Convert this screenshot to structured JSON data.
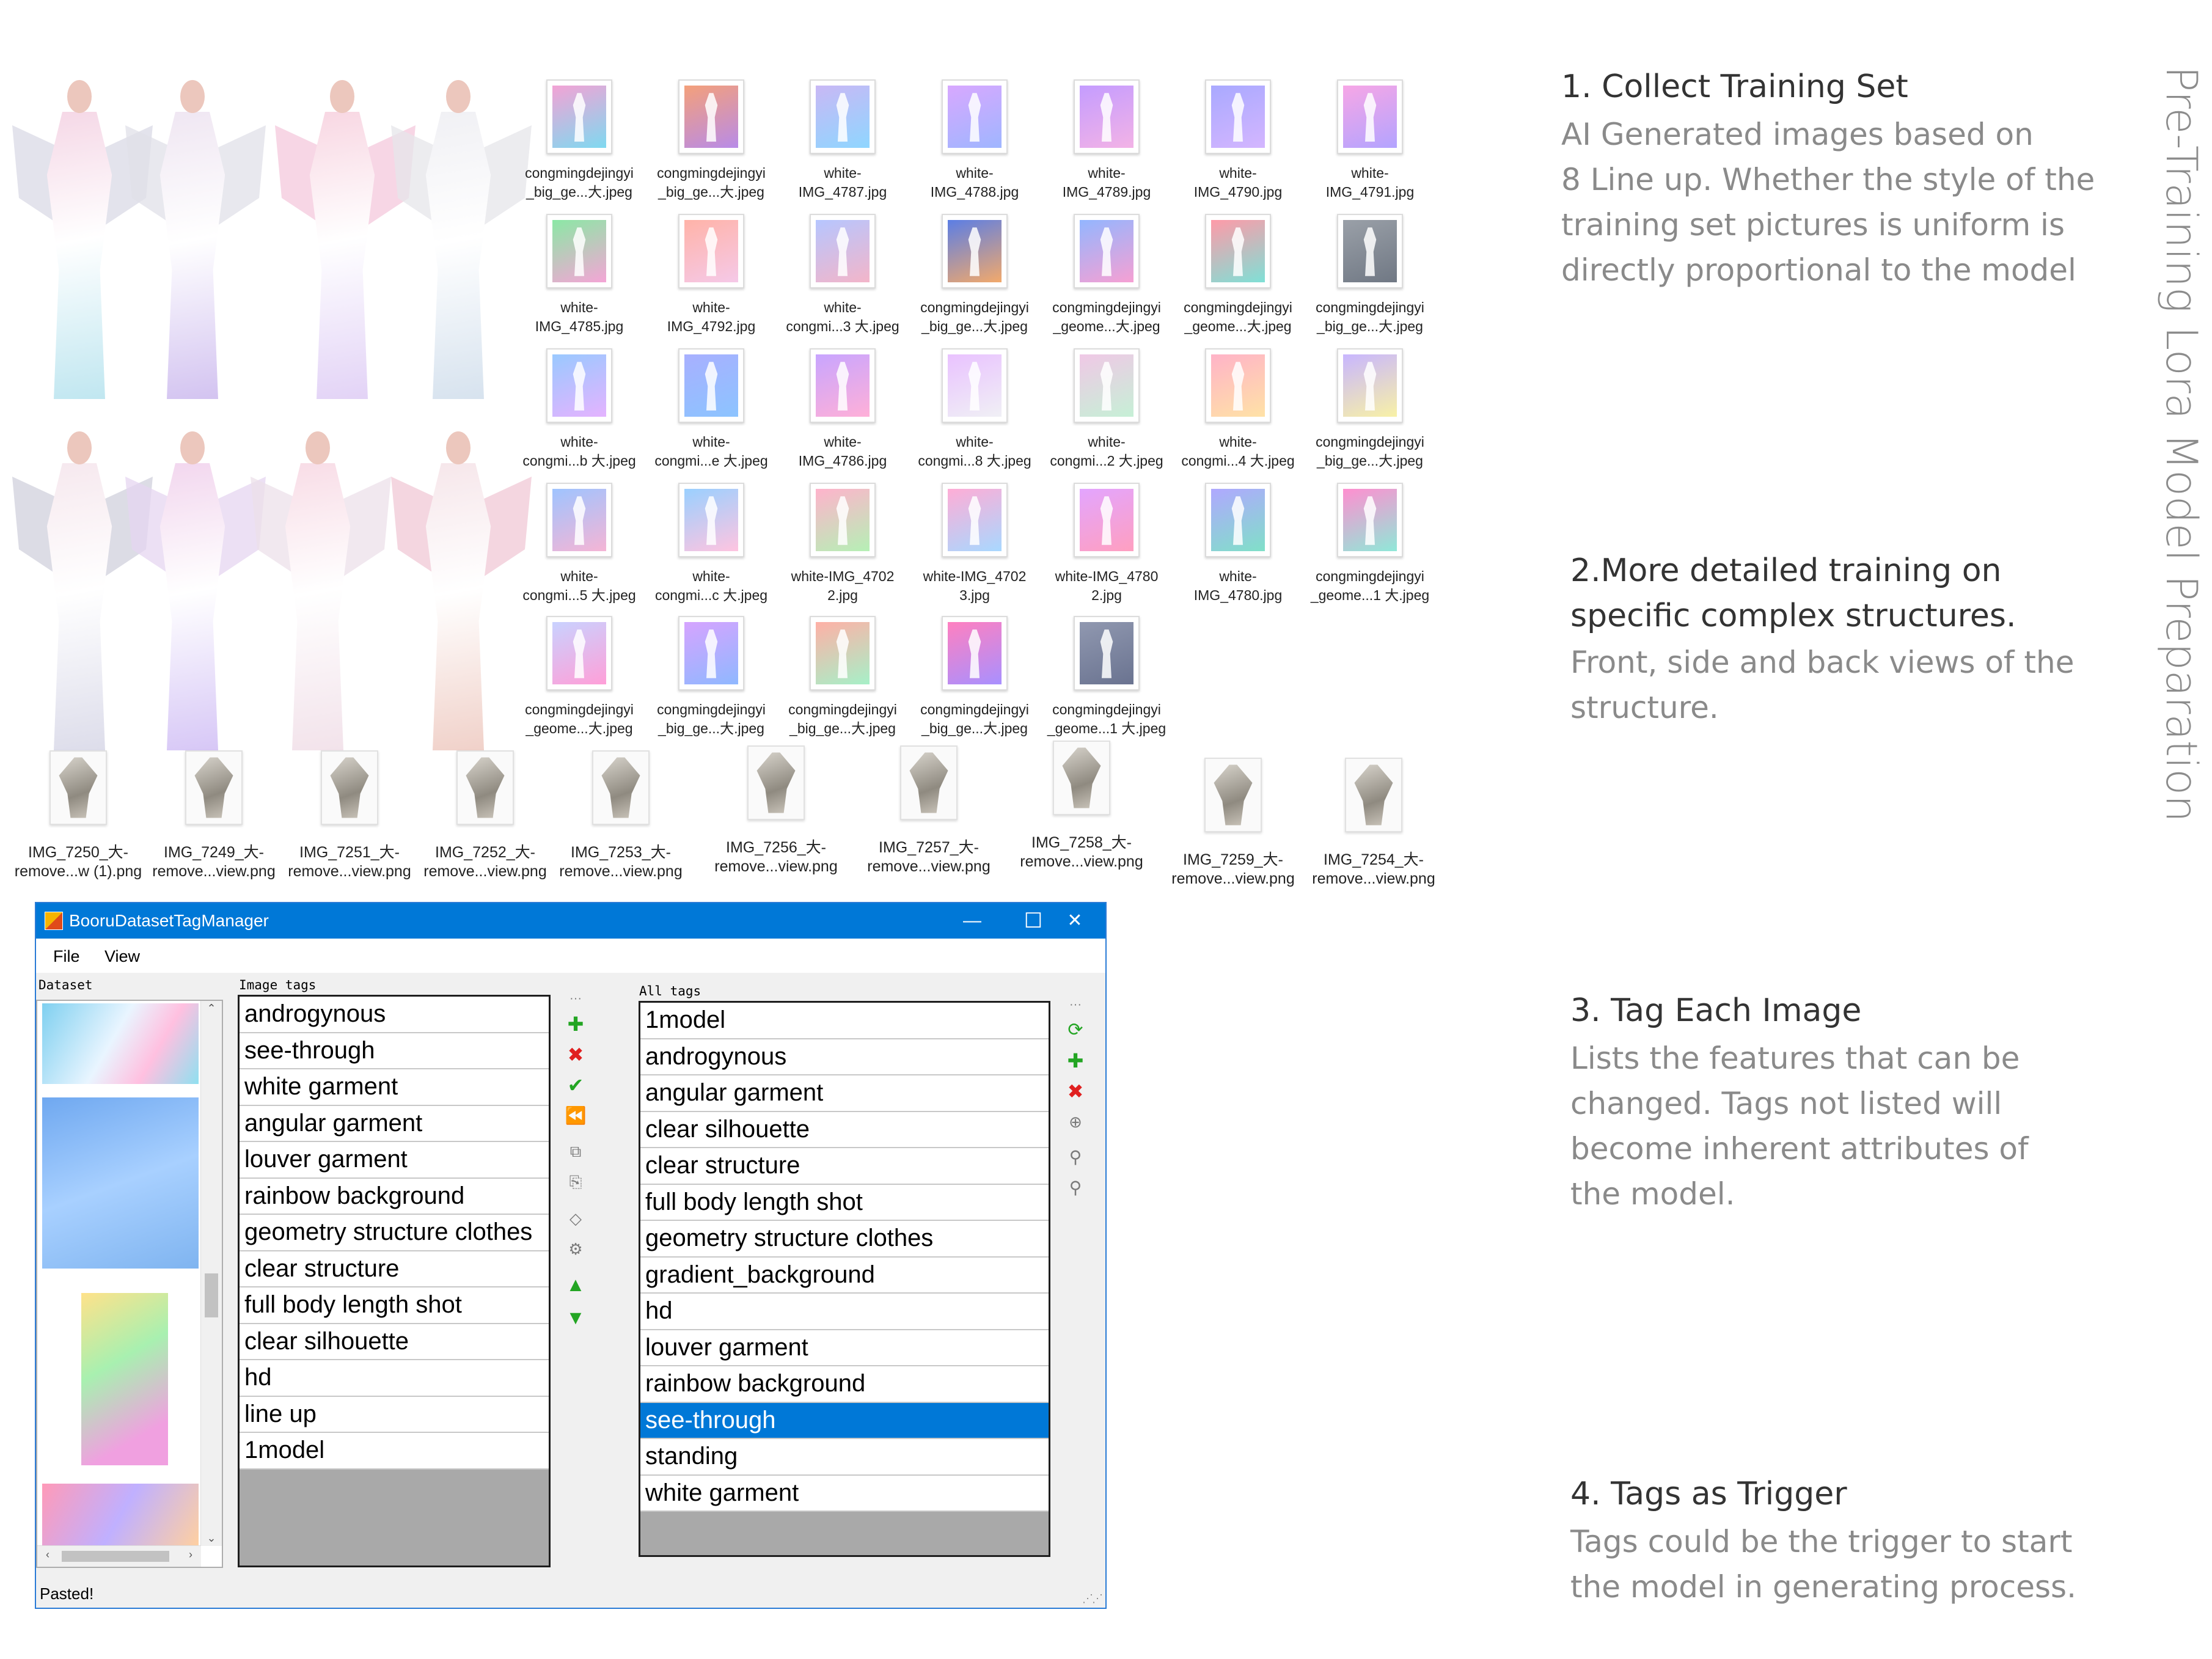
{
  "thumbnails": [
    {
      "line1": "congmingdejingyi",
      "line2": "_big_ge...大.jpeg",
      "colors": [
        "#f3a3d5",
        "#7fd9f0"
      ]
    },
    {
      "line1": "congmingdejingyi",
      "line2": "_big_ge...大.jpeg",
      "colors": [
        "#f4a07a",
        "#b88be8"
      ]
    },
    {
      "line1": "white-",
      "line2": "IMG_4787.jpg",
      "colors": [
        "#c9b8f5",
        "#8fd6ff"
      ]
    },
    {
      "line1": "white-",
      "line2": "IMG_4788.jpg",
      "colors": [
        "#d8a8ff",
        "#9fb6ff"
      ]
    },
    {
      "line1": "white-",
      "line2": "IMG_4789.jpg",
      "colors": [
        "#c49cff",
        "#f3b3e6"
      ]
    },
    {
      "line1": "white-",
      "line2": "IMG_4790.jpg",
      "colors": [
        "#a9a9ff",
        "#d4b6ff"
      ]
    },
    {
      "line1": "white-",
      "line2": "IMG_4791.jpg",
      "colors": [
        "#f7a6e6",
        "#b3a4ff"
      ]
    },
    {
      "line1": "white-",
      "line2": "IMG_4785.jpg",
      "colors": [
        "#8be8a5",
        "#f4a5d6"
      ]
    },
    {
      "line1": "white-",
      "line2": "IMG_4792.jpg",
      "colors": [
        "#ffb3a8",
        "#f5c9e8"
      ]
    },
    {
      "line1": "white-",
      "line2": "congmi...3 大.jpeg",
      "colors": [
        "#b6c6ff",
        "#f3b5c9"
      ]
    },
    {
      "line1": "congmingdejingyi",
      "line2": "_big_ge...大.jpeg",
      "colors": [
        "#5b7ee5",
        "#f2a96b"
      ]
    },
    {
      "line1": "congmingdejingyi",
      "line2": "_geome...大.jpeg",
      "colors": [
        "#93b6ff",
        "#f6a0d3"
      ]
    },
    {
      "line1": "congmingdejingyi",
      "line2": "_geome...大.jpeg",
      "colors": [
        "#ff9aa8",
        "#7fe0d6"
      ]
    },
    {
      "line1": "congmingdejingyi",
      "line2": "_big_ge...大.jpeg",
      "colors": [
        "#9aa0a8",
        "#707884"
      ]
    },
    {
      "line1": "white-",
      "line2": "congmi...b 大.jpeg",
      "colors": [
        "#9ac9ff",
        "#e4b3ff"
      ]
    },
    {
      "line1": "white-",
      "line2": "congmi...e 大.jpeg",
      "colors": [
        "#a8b0ff",
        "#8cc4ff"
      ]
    },
    {
      "line1": "white-",
      "line2": "IMG_4786.jpg",
      "colors": [
        "#c8a5ff",
        "#ffb0d8"
      ]
    },
    {
      "line1": "white-",
      "line2": "congmi...8 大.jpeg",
      "colors": [
        "#e9c2ff",
        "#f0f0f5"
      ]
    },
    {
      "line1": "white-",
      "line2": "congmi...2 大.jpeg",
      "colors": [
        "#f0c8e6",
        "#c6f0d6"
      ]
    },
    {
      "line1": "white-",
      "line2": "congmi...4 大.jpeg",
      "colors": [
        "#ffb3c8",
        "#ffe2a6"
      ]
    },
    {
      "line1": "congmingdejingyi",
      "line2": "_big_ge...大.jpeg",
      "colors": [
        "#c8b6ff",
        "#f8f1a6"
      ]
    },
    {
      "line1": "white-",
      "line2": "congmi...5 大.jpeg",
      "colors": [
        "#9fc4ff",
        "#f5b5d5"
      ]
    },
    {
      "line1": "white-",
      "line2": "congmi...c 大.jpeg",
      "colors": [
        "#9ad0ff",
        "#ffc4e0"
      ]
    },
    {
      "line1": "white-IMG_4702",
      "line2": "2.jpg",
      "colors": [
        "#ffb3cc",
        "#b5f0b5"
      ]
    },
    {
      "line1": "white-IMG_4702",
      "line2": "3.jpg",
      "colors": [
        "#ffadd6",
        "#a8d8ff"
      ]
    },
    {
      "line1": "white-IMG_4780",
      "line2": "2.jpg",
      "colors": [
        "#e3a5ff",
        "#ff9fc0"
      ]
    },
    {
      "line1": "white-",
      "line2": "IMG_4780.jpg",
      "colors": [
        "#b0a8ff",
        "#80e0c8"
      ]
    },
    {
      "line1": "congmingdejingyi",
      "line2": "_geome...1 大.jpeg",
      "colors": [
        "#ff8fd0",
        "#8fe8d8"
      ]
    },
    {
      "line1": "congmingdejingyi",
      "line2": "_geome...大.jpeg",
      "colors": [
        "#c9d2ff",
        "#ff9fd8"
      ]
    },
    {
      "line1": "congmingdejingyi",
      "line2": "_big_ge...大.jpeg",
      "colors": [
        "#d6a4ff",
        "#8fb8ff"
      ]
    },
    {
      "line1": "congmingdejingyi",
      "line2": "_big_ge...大.jpeg",
      "colors": [
        "#ffb0a6",
        "#a6f0c8"
      ]
    },
    {
      "line1": "congmingdejingyi",
      "line2": "_big_ge...大.jpeg",
      "colors": [
        "#ff80c0",
        "#a890ff"
      ]
    },
    {
      "line1": "congmingdejingyi",
      "line2": "_geome...1 大.jpeg",
      "colors": [
        "#9098b0",
        "#6a7390"
      ]
    }
  ],
  "product_thumbnails": [
    {
      "line1": "IMG_7250_大-",
      "line2": "remove...w (1).png"
    },
    {
      "line1": "IMG_7249_大-",
      "line2": "remove...view.png"
    },
    {
      "line1": "IMG_7251_大-",
      "line2": "remove...view.png"
    },
    {
      "line1": "IMG_7252_大-",
      "line2": "remove...view.png"
    },
    {
      "line1": "IMG_7253_大-",
      "line2": "remove...view.png"
    },
    {
      "line1": "IMG_7256_大-",
      "line2": "remove...view.png"
    },
    {
      "line1": "IMG_7257_大-",
      "line2": "remove...view.png"
    },
    {
      "line1": "IMG_7258_大-",
      "line2": "remove...view.png"
    },
    {
      "line1": "IMG_7259_大-",
      "line2": "remove...view.png"
    },
    {
      "line1": "IMG_7254_大-",
      "line2": "remove...view.png"
    }
  ],
  "window": {
    "title": "BooruDatasetTagManager",
    "minimize": "—",
    "maximize": "☐",
    "close": "✕",
    "menu": [
      "File",
      "View"
    ],
    "labels": {
      "dataset": "Dataset",
      "image_tags": "Image tags",
      "all_tags": "All tags"
    },
    "image_tags": [
      "androgynous",
      "see-through",
      "white garment",
      "angular garment",
      "louver garment",
      "rainbow background",
      "geometry structure clothes",
      "clear structure",
      "full body length shot",
      "clear silhouette",
      "hd",
      "line up",
      "1model"
    ],
    "all_tags": [
      "1model",
      "androgynous",
      "angular garment",
      "clear silhouette",
      "clear structure",
      "full body length shot",
      "geometry structure clothes",
      "gradient_background",
      "hd",
      "louver garment",
      "rainbow background",
      "see-through",
      "standing",
      "white garment"
    ],
    "selected_all_tag": "see-through",
    "status": "Pasted!"
  },
  "steps": [
    {
      "title": "1. Collect Training Set",
      "body": [
        "AI Generated images based on",
        "8 Line up. Whether the style of the",
        "training set pictures is uniform is",
        "directly proportional to the model"
      ]
    },
    {
      "title_lines": [
        "2.More detailed training on",
        "specific complex structures."
      ],
      "body": [
        "Front, side and back views of the",
        "structure."
      ]
    },
    {
      "title": "3. Tag Each Image",
      "body": [
        "Lists the features that can be",
        "changed. Tags not listed will",
        "become inherent attributes of",
        "the model."
      ]
    },
    {
      "title": "4. Tags as Trigger",
      "body": [
        "Tags could be the trigger to start",
        "the model in generating process."
      ]
    }
  ],
  "vertical_title": "Pre-Training Lora Model Preparation"
}
